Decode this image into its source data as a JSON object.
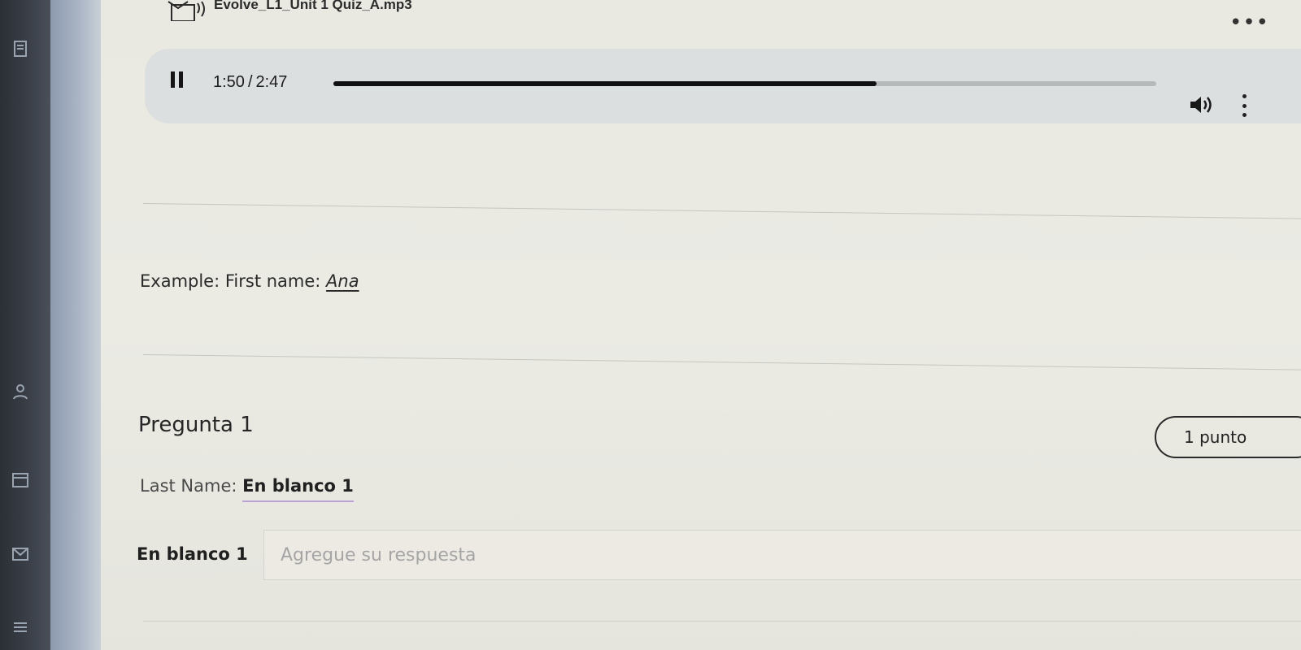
{
  "audio": {
    "filename": "Evolve_L1_Unit 1 Quiz_A.mp3",
    "current_time": "1:50",
    "separator": "/",
    "duration": "2:47",
    "progress": 0.66,
    "icons": {
      "file": "audio-file-icon",
      "more": "more-horizontal-icon",
      "pause": "pause-icon",
      "volume": "volume-icon",
      "options": "more-vertical-icon"
    }
  },
  "example": {
    "label": "Example: First name:",
    "answer": "Ana"
  },
  "question": {
    "title": "Pregunta 1",
    "points": "1 punto",
    "prompt_label": "Last Name:",
    "blank_ref": "En blanco 1",
    "answer_label": "En blanco 1",
    "answer_placeholder": "Agregue su respuesta",
    "answer_value": ""
  },
  "colors": {
    "accent_underline": "#b9a3d3",
    "player_background": "#dcdfe0",
    "rail": "#2b2f36"
  }
}
